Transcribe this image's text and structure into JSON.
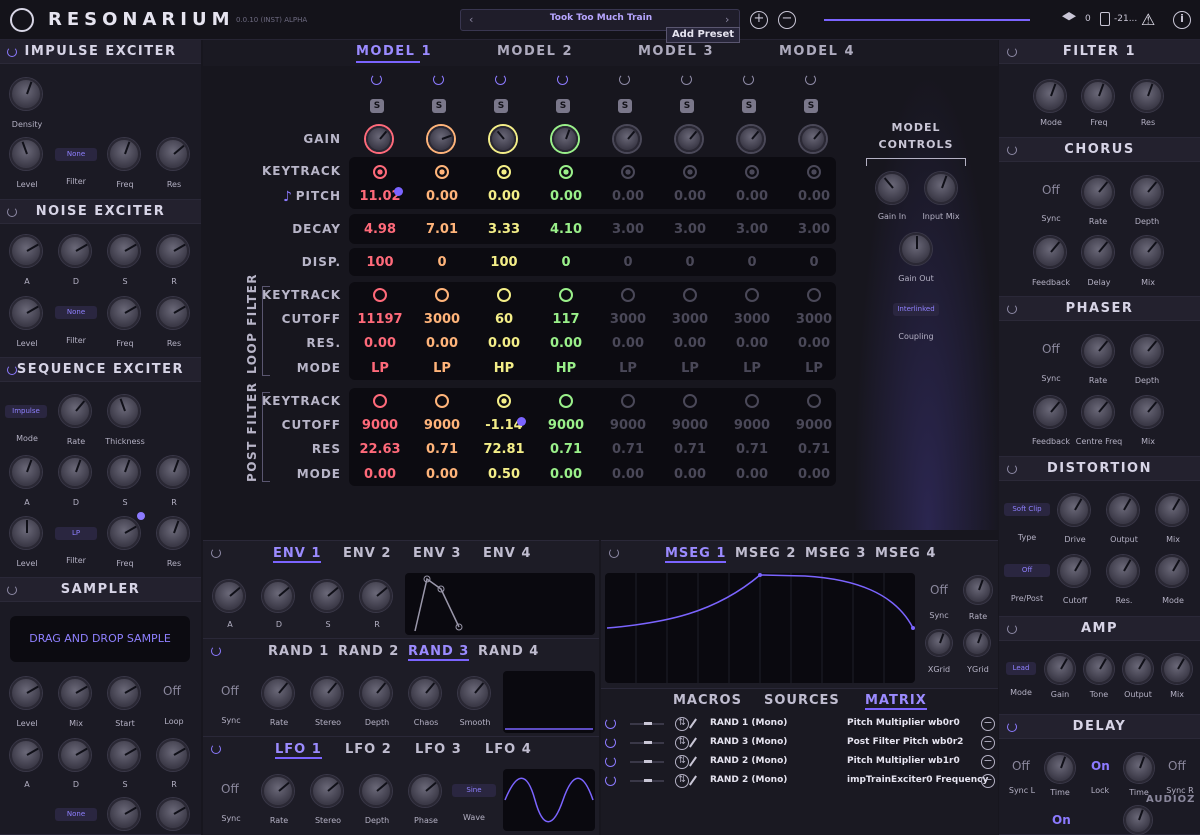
{
  "app": {
    "name": "RESONARIUM",
    "version": "0.0.10 (INST) ALPHA"
  },
  "preset": {
    "name": "Took Too Much Train",
    "add_label": "Add Preset"
  },
  "topbar": {
    "counter": "0",
    "cpu": "-21..."
  },
  "impulse": {
    "title": "IMPULSE EXCITER",
    "density": "Density",
    "level": "Level",
    "filter": "Filter",
    "filter_val": "None",
    "freq": "Freq",
    "res": "Res"
  },
  "noise": {
    "title": "NOISE EXCITER",
    "a": "A",
    "d": "D",
    "s": "S",
    "r": "R",
    "level": "Level",
    "filter": "Filter",
    "filter_val": "None",
    "freq": "Freq",
    "res": "Res"
  },
  "sequence": {
    "title": "SEQUENCE EXCITER",
    "mode": "Mode",
    "mode_val": "Impulse",
    "rate": "Rate",
    "thickness": "Thickness",
    "a": "A",
    "d": "D",
    "s": "S",
    "r": "R",
    "level": "Level",
    "filter": "Filter",
    "filter_val": "LP",
    "freq": "Freq",
    "res": "Res"
  },
  "sampler": {
    "title": "SAMPLER",
    "drop": "DRAG AND DROP SAMPLE",
    "level": "Level",
    "mix": "Mix",
    "start": "Start",
    "loop": "Loop",
    "loop_val": "Off",
    "a": "A",
    "d": "D",
    "s": "S",
    "r": "R",
    "filter_val": "None"
  },
  "models": {
    "tabs": [
      "MODEL 1",
      "MODEL 2",
      "MODEL 3",
      "MODEL 4"
    ],
    "rows": {
      "gain": "GAIN",
      "keytrack": "KEYTRACK",
      "pitch": "PITCH",
      "decay": "DECAY",
      "disp": "DISP.",
      "lf_keytrack": "KEYTRACK",
      "cutoff": "CUTOFF",
      "res": "RES.",
      "mode": "MODE",
      "pf_keytrack": "KEYTRACK",
      "pf_cutoff": "CUTOFF",
      "pf_res": "RES",
      "pf_mode": "MODE"
    },
    "loop_filter": "LOOP FILTER",
    "post_filter": "POST FILTER",
    "pitch": [
      "11.02",
      "0.00",
      "0.00",
      "0.00",
      "0.00",
      "0.00",
      "0.00",
      "0.00"
    ],
    "decay": [
      "4.98",
      "7.01",
      "3.33",
      "4.10",
      "3.00",
      "3.00",
      "3.00",
      "3.00"
    ],
    "disp": [
      "100",
      "0",
      "100",
      "0",
      "0",
      "0",
      "0",
      "0"
    ],
    "lf_cutoff": [
      "11197",
      "3000",
      "60",
      "117",
      "3000",
      "3000",
      "3000",
      "3000"
    ],
    "lf_res": [
      "0.00",
      "0.00",
      "0.00",
      "0.00",
      "0.00",
      "0.00",
      "0.00",
      "0.00"
    ],
    "lf_mode": [
      "LP",
      "LP",
      "HP",
      "HP",
      "LP",
      "LP",
      "LP",
      "LP"
    ],
    "pf_cutoff": [
      "9000",
      "9000",
      "-1.14",
      "9000",
      "9000",
      "9000",
      "9000",
      "9000"
    ],
    "pf_res": [
      "22.63",
      "0.71",
      "72.81",
      "0.71",
      "0.71",
      "0.71",
      "0.71",
      "0.71"
    ],
    "pf_mode": [
      "0.00",
      "0.00",
      "0.50",
      "0.00",
      "0.00",
      "0.00",
      "0.00",
      "0.00"
    ],
    "solo": "S",
    "colors": [
      "#ff6a7a",
      "#ffb47a",
      "#f4ee88",
      "#9af08a",
      "#4a4858",
      "#4a4858",
      "#4a4858",
      "#4a4858"
    ]
  },
  "model_controls": {
    "title1": "MODEL",
    "title2": "CONTROLS",
    "gain_in": "Gain In",
    "input_mix": "Input Mix",
    "gain_out": "Gain Out",
    "coupling_val": "Interlinked",
    "coupling": "Coupling"
  },
  "filter1": {
    "title": "FILTER 1",
    "mode": "Mode",
    "freq": "Freq",
    "res": "Res"
  },
  "chorus": {
    "title": "CHORUS",
    "sync_val": "Off",
    "sync": "Sync",
    "rate": "Rate",
    "depth": "Depth",
    "feedback": "Feedback",
    "delay": "Delay",
    "mix": "Mix"
  },
  "phaser": {
    "title": "PHASER",
    "sync_val": "Off",
    "sync": "Sync",
    "rate": "Rate",
    "depth": "Depth",
    "feedback": "Feedback",
    "centre": "Centre Freq",
    "mix": "Mix"
  },
  "distortion": {
    "title": "DISTORTION",
    "type_val": "Soft Clip",
    "type": "Type",
    "drive": "Drive",
    "output": "Output",
    "mix": "Mix",
    "prepost_val": "Off",
    "prepost": "Pre/Post",
    "cutoff": "Cutoff",
    "res": "Res.",
    "mode": "Mode"
  },
  "amp": {
    "title": "AMP",
    "mode_val": "Lead",
    "mode": "Mode",
    "gain": "Gain",
    "tone": "Tone",
    "output": "Output",
    "mix": "Mix"
  },
  "delay": {
    "title": "DELAY",
    "sync_l_val": "Off",
    "sync_l": "Sync L",
    "time": "Time",
    "lock_val": "On",
    "lock": "Lock",
    "time2": "Time",
    "sync_r_val": "Off",
    "sync_r": "Sync R",
    "on2": "On"
  },
  "env": {
    "tabs": [
      "ENV 1",
      "ENV 2",
      "ENV 3",
      "ENV 4"
    ],
    "a": "A",
    "d": "D",
    "s": "S",
    "r": "R"
  },
  "rand": {
    "tabs": [
      "RAND 1",
      "RAND 2",
      "RAND 3",
      "RAND 4"
    ],
    "sync_val": "Off",
    "sync": "Sync",
    "rate": "Rate",
    "stereo": "Stereo",
    "depth": "Depth",
    "chaos": "Chaos",
    "smooth": "Smooth"
  },
  "lfo": {
    "tabs": [
      "LFO 1",
      "LFO 2",
      "LFO 3",
      "LFO 4"
    ],
    "sync_val": "Off",
    "sync": "Sync",
    "rate": "Rate",
    "stereo": "Stereo",
    "depth": "Depth",
    "phase": "Phase",
    "wave_val": "Sine",
    "wave": "Wave"
  },
  "mseg": {
    "tabs": [
      "MSEG 1",
      "MSEG 2",
      "MSEG 3",
      "MSEG 4"
    ],
    "sync_val": "Off",
    "sync": "Sync",
    "rate": "Rate",
    "xgrid": "XGrid",
    "ygrid": "YGrid"
  },
  "matrix": {
    "tabs": [
      "MACROS",
      "SOURCES",
      "MATRIX"
    ],
    "rows": [
      {
        "src": "RAND 1 (Mono)",
        "dst": "Pitch Multiplier wb0r0"
      },
      {
        "src": "RAND 3 (Mono)",
        "dst": "Post Filter Pitch wb0r2"
      },
      {
        "src": "RAND 2 (Mono)",
        "dst": "Pitch Multiplier wb1r0"
      },
      {
        "src": "RAND 2 (Mono)",
        "dst": "impTrainExciter0 Frequency"
      }
    ]
  },
  "watermark": "AUDIOZ"
}
